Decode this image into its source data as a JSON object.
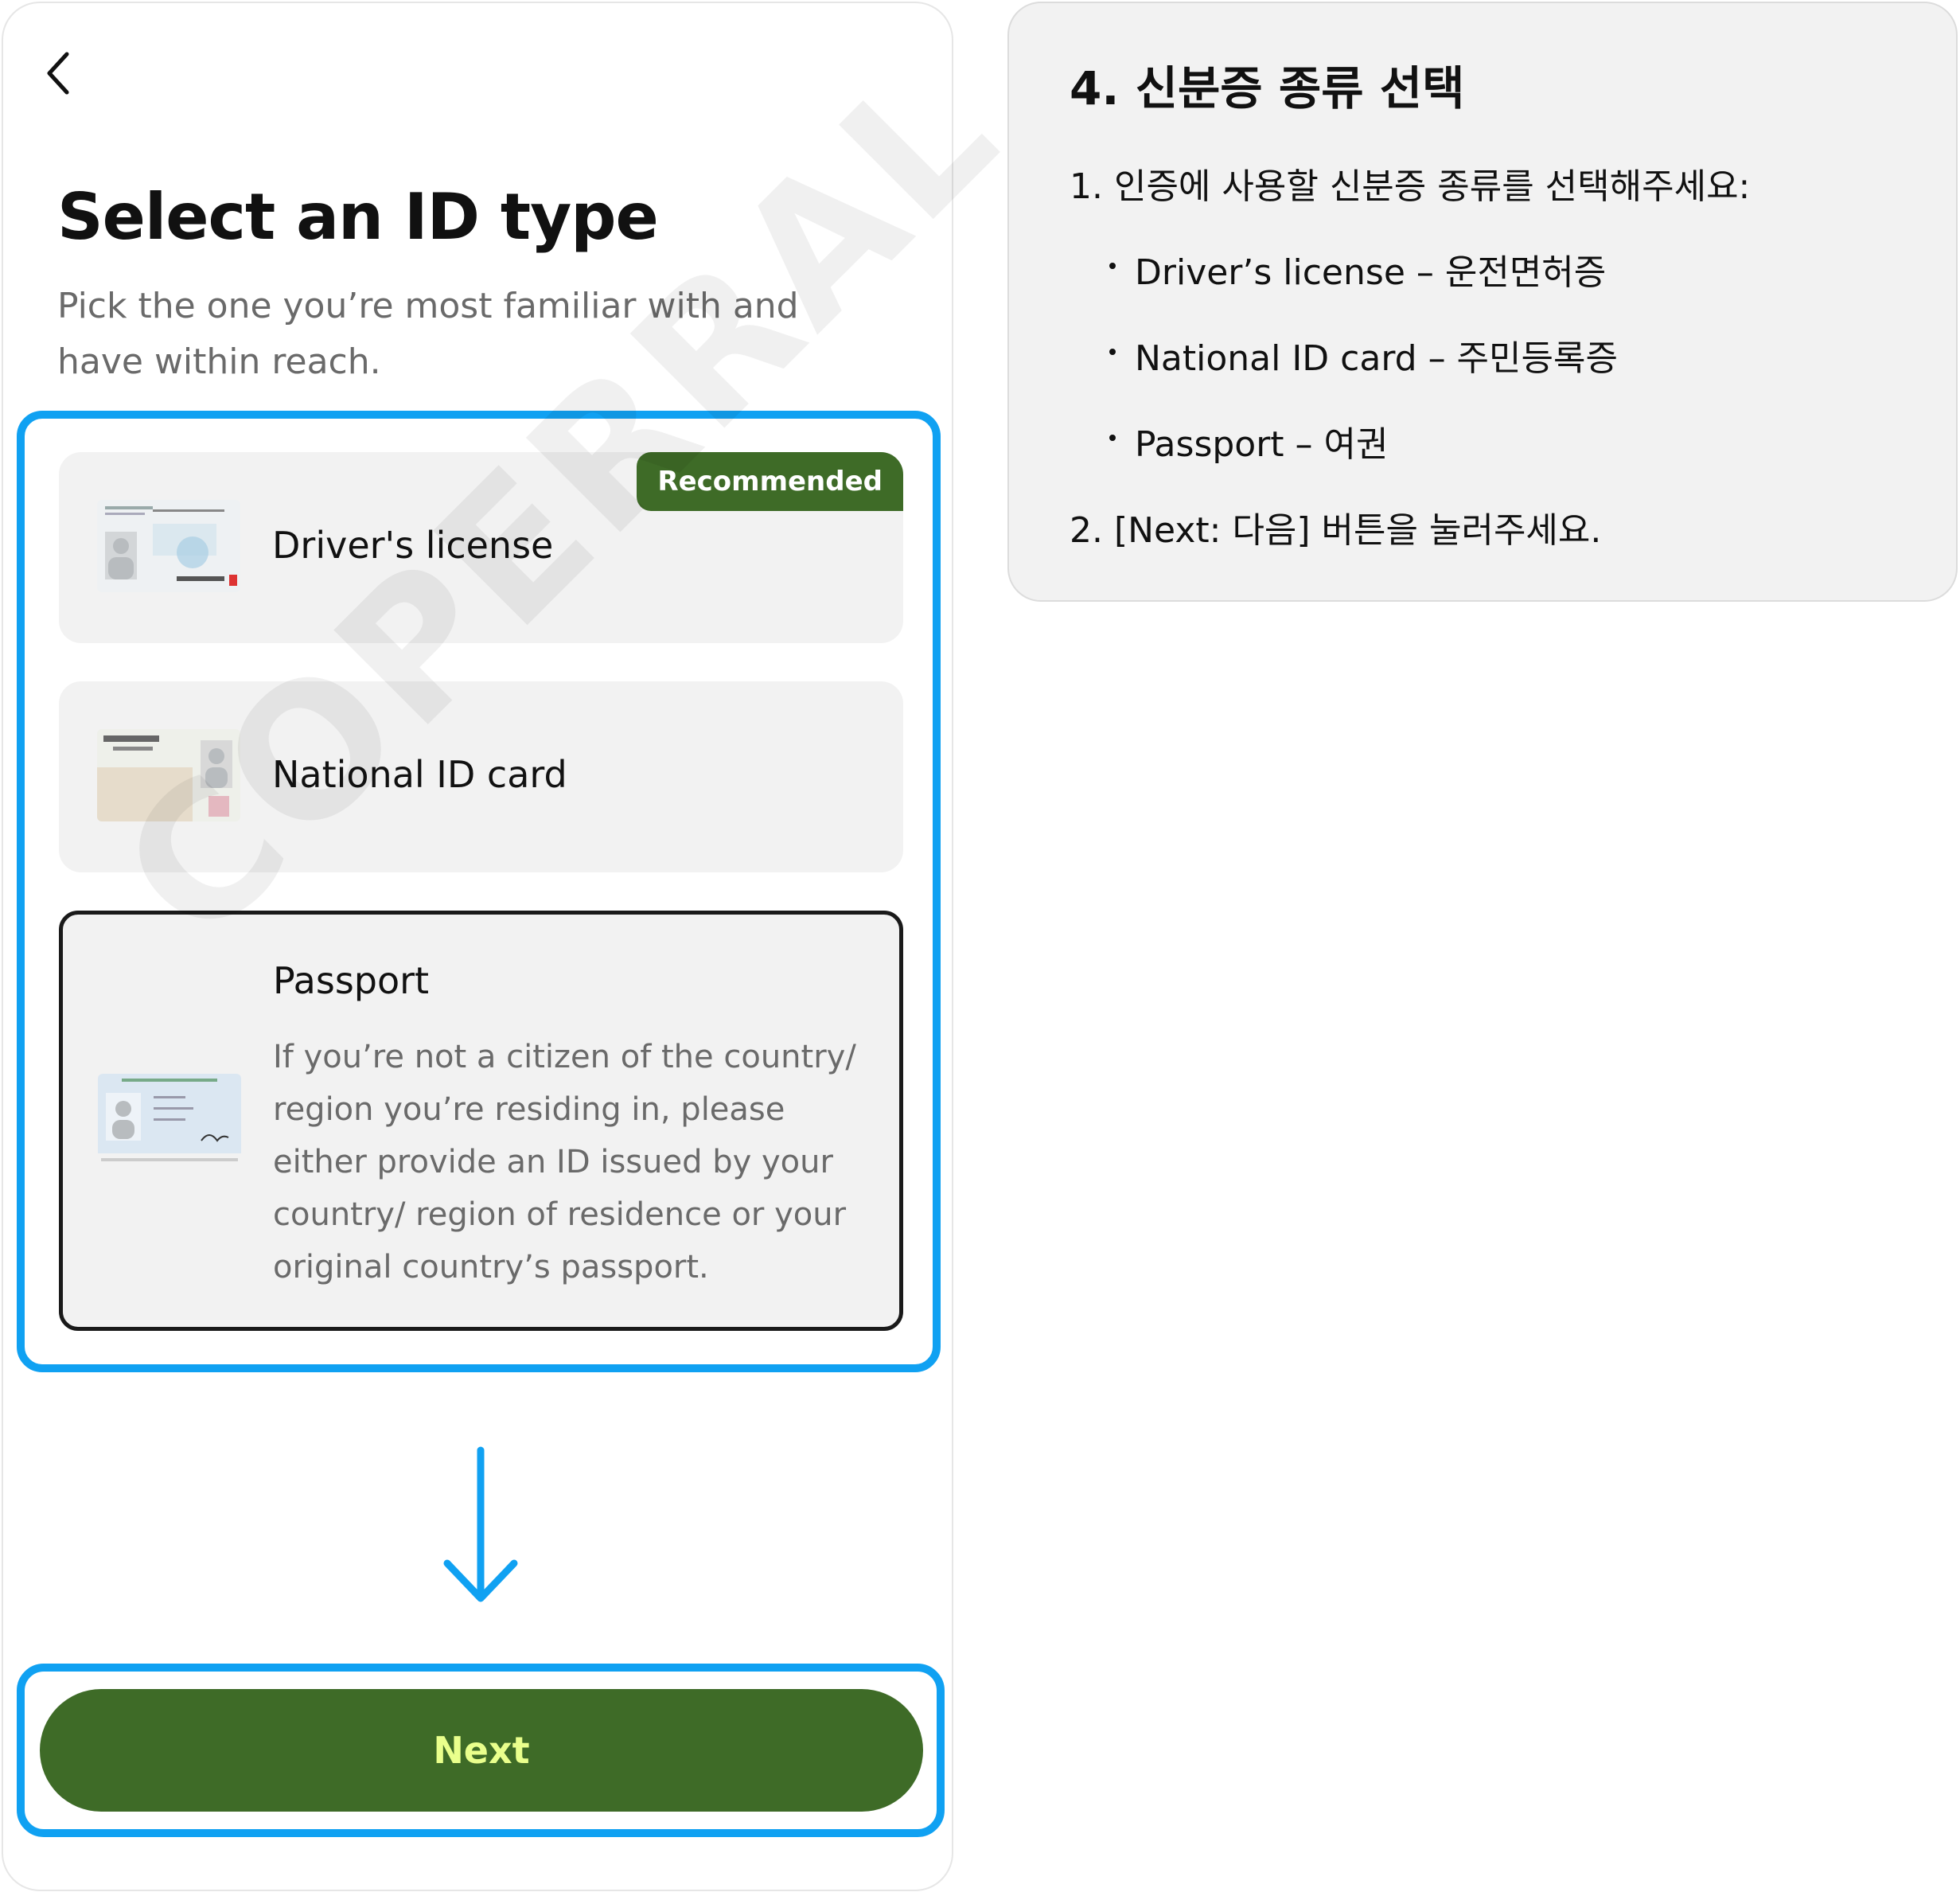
{
  "screen": {
    "title": "Select an ID type",
    "subtitle": "Pick the one you’re most familiar with and have within reach.",
    "options": [
      {
        "label": "Driver's license",
        "badge": "Recommended"
      },
      {
        "label": "National ID card"
      },
      {
        "label": "Passport",
        "description": "If you’re not a citizen of the country/ region you’re residing in, please either provide an ID issued by your country/ region of residence or your original country’s passport."
      }
    ],
    "next_label": "Next",
    "watermark": "COPERRAL",
    "accent_color": "#3e6b27",
    "highlight_color": "#10a1f2"
  },
  "instructions": {
    "title": "4. 신분증 종류 선택",
    "step1": "1. 인증에 사용할 신분증 종류를 선택해주세요:",
    "bullets": [
      "Driver’s license – 운전면허증",
      "National ID card – 주민등록증",
      "Passport – 여권"
    ],
    "step2": "2. [Next: 다음] 버튼을 눌러주세요."
  }
}
